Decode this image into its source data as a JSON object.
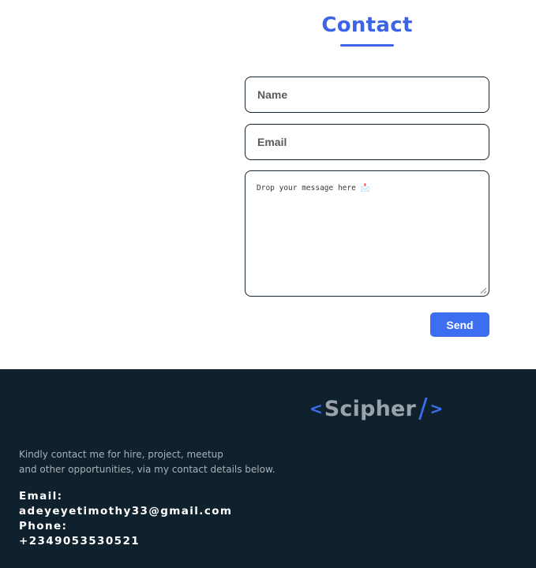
{
  "contact": {
    "title": "Contact",
    "name_placeholder": "Name",
    "email_placeholder": "Email",
    "message_placeholder": "Drop your message here 📩",
    "send_label": "Send"
  },
  "footer": {
    "logo": {
      "open_bracket": "<",
      "name": "Scipher",
      "slash": "/",
      "close_bracket": ">"
    },
    "description_lines": [
      "Kindly contact me for hire, project, meetup",
      "and other opportunities, via my contact details below."
    ],
    "email_label": "Email:",
    "email_value": "adeyeyetimothy33@gmail.com",
    "phone_label": "Phone:",
    "phone_value": "+2349053530521"
  },
  "colors": {
    "accent": "#3d6ef2",
    "title": "#3d63e6",
    "footer_bg": "#10212e",
    "field_border": "#13232f"
  }
}
